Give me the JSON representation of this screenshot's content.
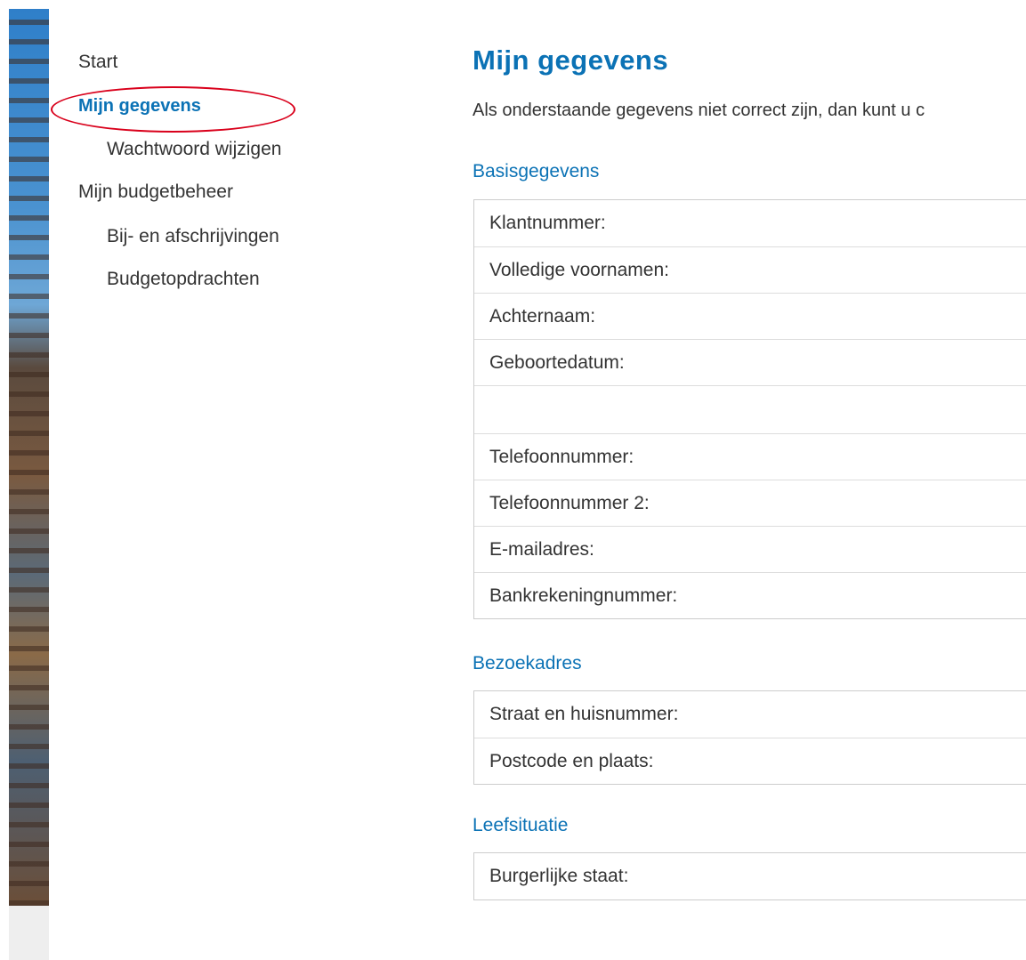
{
  "sidebar": {
    "items": [
      {
        "label": "Start"
      },
      {
        "label": "Mijn gegevens",
        "active": true
      },
      {
        "label": "Wachtwoord wijzigen"
      },
      {
        "label": "Mijn budgetbeheer"
      },
      {
        "label": "Bij- en afschrijvingen"
      },
      {
        "label": "Budgetopdrachten"
      }
    ]
  },
  "main": {
    "title": "Mijn gegevens",
    "intro": "Als onderstaande gegevens niet correct zijn, dan kunt u c",
    "sections": [
      {
        "heading": "Basisgegevens",
        "rows": [
          "Klantnummer:",
          "Volledige voornamen:",
          "Achternaam:",
          "Geboortedatum:",
          "",
          "Telefoonnummer:",
          "Telefoonnummer 2:",
          "E-mailadres:",
          "Bankrekeningnummer:"
        ]
      },
      {
        "heading": "Bezoekadres",
        "rows": [
          "Straat en huisnummer:",
          "Postcode en plaats:"
        ]
      },
      {
        "heading": "Leefsituatie",
        "rows": [
          "Burgerlijke staat:"
        ]
      }
    ]
  },
  "colors": {
    "accent": "#0b72b5",
    "highlight_ring": "#d9001b",
    "text": "#333333",
    "border": "#cccccc"
  }
}
